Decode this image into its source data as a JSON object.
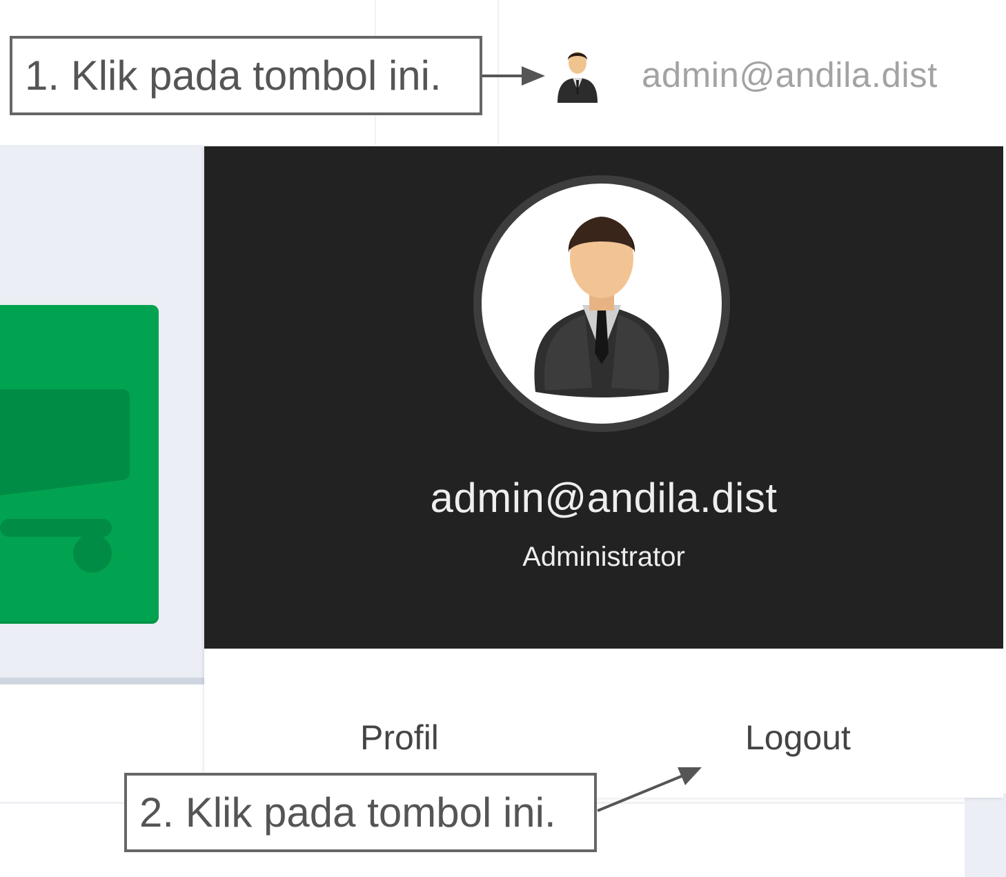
{
  "header": {
    "user_email": "admin@andila.dist",
    "avatar_icon": "user-avatar-icon"
  },
  "user_dropdown": {
    "email": "admin@andila.dist",
    "role": "Administrator",
    "profile_label": "Profil",
    "logout_label": "Logout",
    "header_background": "#222222"
  },
  "background_card": {
    "accent_color": "#02a350",
    "icon": "truck-icon"
  },
  "annotations": {
    "step1": "1. Klik pada tombol ini.",
    "step2": "2. Klik pada tombol ini."
  }
}
